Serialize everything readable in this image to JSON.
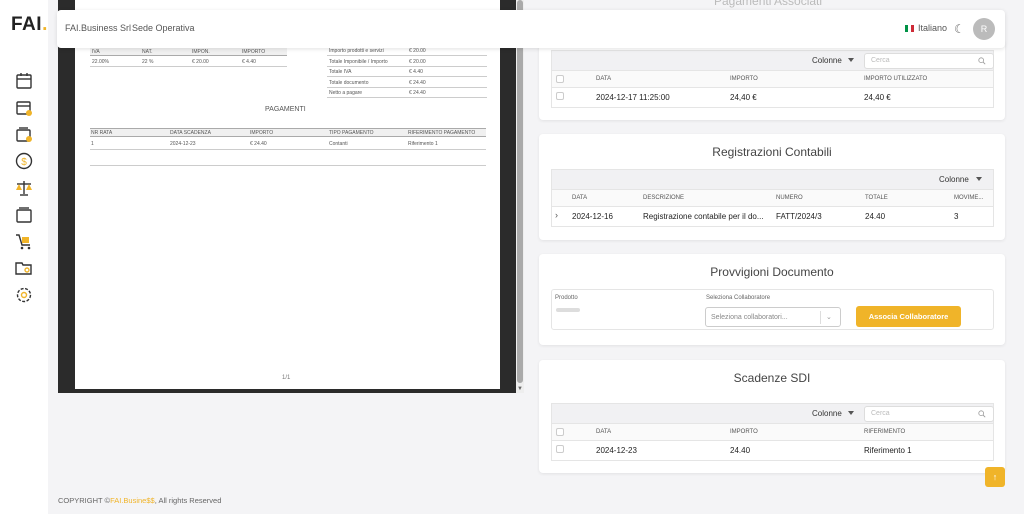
{
  "brand": {
    "logo_text": "FAI",
    "logo_dot": "."
  },
  "topbar": {
    "company": "FAI.Business Srl",
    "sede": "Sede Operativa",
    "language": "Italiano",
    "avatar_initial": "R"
  },
  "background_title": "Pagamenti Associati",
  "pdf": {
    "iva_headers": [
      "IVA",
      "NAT.",
      "IMPON.",
      "IMPORTO"
    ],
    "iva_row": [
      "22.00%",
      "22 %",
      "€ 20.00",
      "€ 4.40"
    ],
    "totals": [
      {
        "label": "Importo prodotti e servizi",
        "value": "€ 20.00"
      },
      {
        "label": "Totale Imponibile / Importo",
        "value": "€ 20.00"
      },
      {
        "label": "Totale IVA",
        "value": "€ 4.40"
      },
      {
        "label": "Totale documento",
        "value": "€ 24.40"
      },
      {
        "label": "Netto a pagare",
        "value": "€ 24.40"
      }
    ],
    "pagamenti_title": "PAGAMENTI",
    "pag_headers": [
      "NR RATA",
      "DATA SCADENZA",
      "IMPORTO",
      "TIPO PAGAMENTO",
      "RIFERIMENTO PAGAMENTO"
    ],
    "pag_row": [
      "1",
      "2024-12-23",
      "€ 24.40",
      "Contanti",
      "Riferimento 1"
    ],
    "page_number": "1/1"
  },
  "pagamenti_card": {
    "colonne": "Colonne",
    "search_placeholder": "Cerca",
    "headers": [
      "DATA",
      "IMPORTO",
      "IMPORTO UTILIZZATO"
    ],
    "row": [
      "2024-12-17 11:25:00",
      "24,40 €",
      "24,40 €"
    ]
  },
  "registrazioni_card": {
    "title": "Registrazioni Contabili",
    "colonne": "Colonne",
    "headers": [
      "DATA",
      "DESCRIZIONE",
      "NUMERO",
      "TOTALE",
      "MOVIME..."
    ],
    "row": [
      "2024-12-16",
      "Registrazione contabile per il do...",
      "FATT/2024/3",
      "24.40",
      "3"
    ]
  },
  "provvigioni_card": {
    "title": "Provvigioni Documento",
    "prodotto_label": "Prodotto",
    "collab_label": "Seleziona Collaboratore",
    "select_placeholder": "Seleziona collaboratori...",
    "button": "Associa Collaboratore"
  },
  "sdi_card": {
    "title": "Scadenze SDI",
    "colonne": "Colonne",
    "search_placeholder": "Cerca",
    "headers": [
      "DATA",
      "IMPORTO",
      "RIFERIMENTO"
    ],
    "row": [
      "2024-12-23",
      "24.40",
      "Riferimento 1"
    ]
  },
  "footer": {
    "prefix": "COPYRIGHT ©",
    "brand": "FAI.Busine$$",
    "suffix": ", All rights Reserved"
  },
  "colors": {
    "accent": "#f0b429",
    "text": "#333333"
  }
}
